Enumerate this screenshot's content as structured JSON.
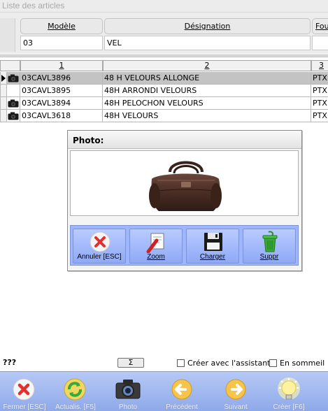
{
  "window": {
    "title": "Liste des articles"
  },
  "filter": {
    "columns": [
      {
        "header": "Modèle",
        "value": "03"
      },
      {
        "header": "Désignation",
        "value": "VEL"
      },
      {
        "header": "Fou",
        "value": ""
      }
    ]
  },
  "grid": {
    "headers": [
      "1",
      "2",
      "3"
    ],
    "rows": [
      {
        "code": "03CAVL3896",
        "designation": "48 H VELOURS ALLONGE",
        "col3": "PTX",
        "has_photo": true,
        "selected": true
      },
      {
        "code": "03CAVL3895",
        "designation": "48H ARRONDI VELOURS",
        "col3": "PTX",
        "has_photo": false,
        "selected": false
      },
      {
        "code": "03CAVL3894",
        "designation": "48H PELOCHON VELOURS",
        "col3": "PTX",
        "has_photo": true,
        "selected": false
      },
      {
        "code": "03CAVL3618",
        "designation": "48H VELOURS",
        "col3": "PTX",
        "has_photo": true,
        "selected": false
      }
    ]
  },
  "photo_dialog": {
    "title": "Photo:",
    "buttons": {
      "cancel": "Annuler [ESC]",
      "zoom": "Zoom",
      "load": "Charger",
      "delete": "Suppr"
    }
  },
  "status": {
    "text": "???",
    "sigma_label": "Σ",
    "create_with_assistant": "Créer avec l'assistant",
    "sleeping": "En sommeil"
  },
  "toolbar": {
    "close": "Fermer [ESC]",
    "refresh": "Actualis. [F5]",
    "photo": "Photo",
    "previous": "Précédent",
    "next": "Suivant",
    "create": "Créer [F6]"
  },
  "icons": {
    "camera": "camera-icon",
    "cancel": "cancel-x-icon",
    "zoom": "zoom-icon",
    "save": "floppy-disk-icon",
    "trash": "trash-bin-icon",
    "refresh": "refresh-icon",
    "prev": "arrow-left-icon",
    "next": "arrow-right-icon",
    "create": "light-bulb-icon"
  },
  "colors": {
    "toolbar_blue": "#9eb6ff",
    "selected_row": "#c3c3c3",
    "bottom_toolbar": "#a3bbf0"
  }
}
